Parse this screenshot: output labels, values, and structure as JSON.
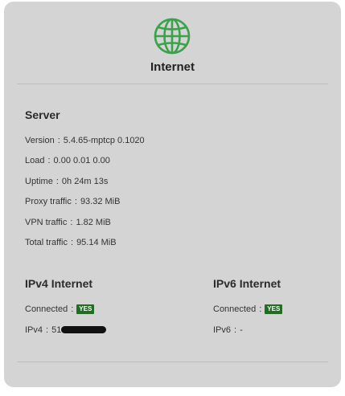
{
  "header": {
    "title": "Internet",
    "icon": "globe-icon",
    "icon_color": "#3aa24a"
  },
  "server": {
    "title": "Server",
    "rows": [
      {
        "label": "Version",
        "value": "5.4.65-mptcp 0.1020"
      },
      {
        "label": "Load",
        "value": "0.00 0.01 0.00"
      },
      {
        "label": "Uptime",
        "value": "0h 24m 13s"
      },
      {
        "label": "Proxy traffic",
        "value": "93.32 MiB"
      },
      {
        "label": "VPN traffic",
        "value": "1.82 MiB"
      },
      {
        "label": "Total traffic",
        "value": "95.14 MiB"
      }
    ]
  },
  "ipv4": {
    "title": "IPv4 Internet",
    "connected_label": "Connected",
    "connected_badge": "YES",
    "address_label": "IPv4",
    "address_value": "51"
  },
  "ipv6": {
    "title": "IPv6 Internet",
    "connected_label": "Connected",
    "connected_badge": "YES",
    "address_label": "IPv6",
    "address_value": "-"
  },
  "colors": {
    "card_bg": "#d4d4d4",
    "badge_bg": "#1f6e24"
  }
}
